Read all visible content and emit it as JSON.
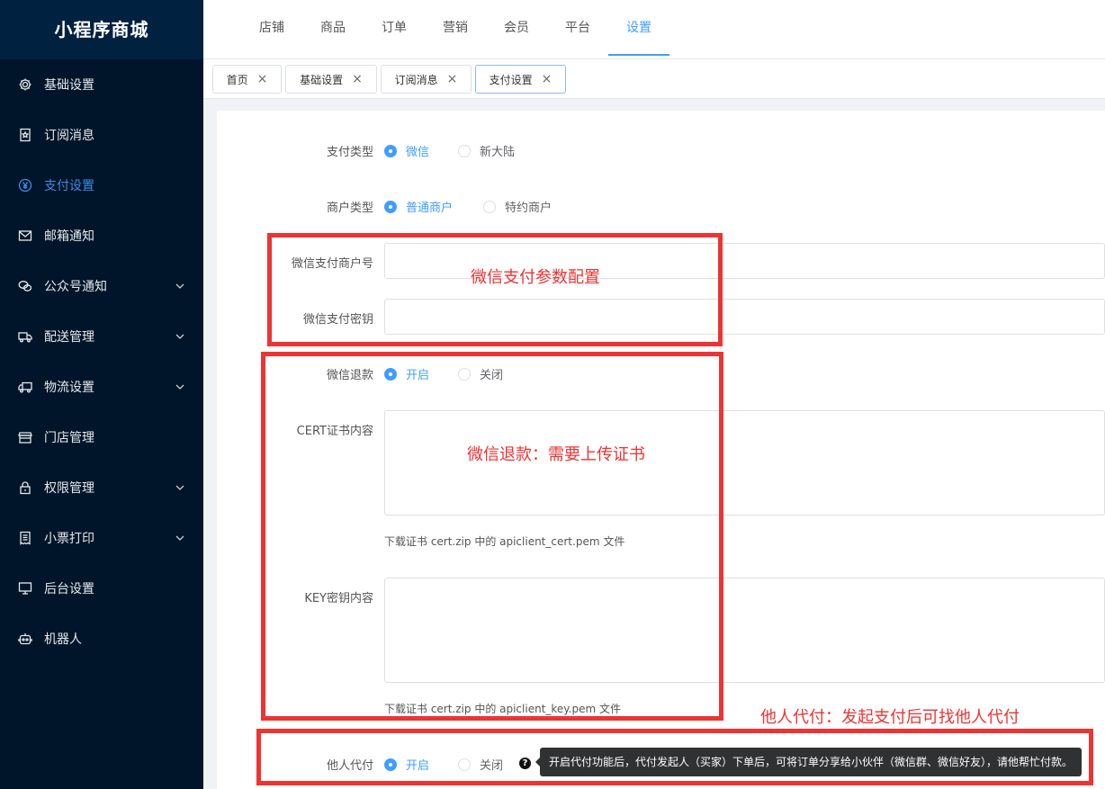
{
  "app": {
    "title": "小程序商城"
  },
  "sidebar": {
    "items": [
      {
        "label": "基础设置",
        "icon": "gear-icon",
        "expandable": false
      },
      {
        "label": "订阅消息",
        "icon": "bookmark-icon",
        "expandable": false
      },
      {
        "label": "支付设置",
        "icon": "yuan-icon",
        "expandable": false,
        "active": true
      },
      {
        "label": "邮箱通知",
        "icon": "mail-icon",
        "expandable": false
      },
      {
        "label": "公众号通知",
        "icon": "wechat-icon",
        "expandable": true
      },
      {
        "label": "配送管理",
        "icon": "delivery-icon",
        "expandable": true
      },
      {
        "label": "物流设置",
        "icon": "truck-icon",
        "expandable": true
      },
      {
        "label": "门店管理",
        "icon": "store-icon",
        "expandable": false
      },
      {
        "label": "权限管理",
        "icon": "lock-icon",
        "expandable": true
      },
      {
        "label": "小票打印",
        "icon": "receipt-icon",
        "expandable": true
      },
      {
        "label": "后台设置",
        "icon": "monitor-icon",
        "expandable": false
      },
      {
        "label": "机器人",
        "icon": "robot-icon",
        "expandable": false
      }
    ]
  },
  "topnav": {
    "tabs": [
      "店铺",
      "商品",
      "订单",
      "营销",
      "会员",
      "平台",
      "设置"
    ],
    "active": "设置"
  },
  "page_tabs": [
    {
      "label": "首页"
    },
    {
      "label": "基础设置"
    },
    {
      "label": "订阅消息"
    },
    {
      "label": "支付设置",
      "active": true
    }
  ],
  "form": {
    "pay_type": {
      "label": "支付类型",
      "options": [
        "微信",
        "新大陆"
      ],
      "selected": "微信"
    },
    "merchant_type": {
      "label": "商户类型",
      "options": [
        "普通商户",
        "特约商户"
      ],
      "selected": "普通商户"
    },
    "mch_id": {
      "label": "微信支付商户号",
      "value": ""
    },
    "mch_key": {
      "label": "微信支付密钥",
      "value": ""
    },
    "refund": {
      "label": "微信退款",
      "options": [
        "开启",
        "关闭"
      ],
      "selected": "开启"
    },
    "cert": {
      "label": "CERT证书内容",
      "value": "",
      "hint": "下载证书 cert.zip 中的 apiclient_cert.pem 文件"
    },
    "key": {
      "label": "KEY密钥内容",
      "value": "",
      "hint": "下载证书 cert.zip 中的 apiclient_key.pem 文件"
    },
    "proxy_pay": {
      "label": "他人代付",
      "options": [
        "开启",
        "关闭"
      ],
      "selected": "开启",
      "tooltip": "开启代付功能后，代付发起人（买家）下单后，可将订单分享给小伙伴（微信群、微信好友），请他帮忙付款。"
    }
  },
  "annotations": {
    "wechat_params": "微信支付参数配置",
    "refund_cert": "微信退款：需要上传证书",
    "proxy_pay": "他人代付：发起支付后可找他人代付"
  },
  "colors": {
    "sidebar_bg": "#001529",
    "accent": "#409eff",
    "annotation": "#ee3333"
  }
}
